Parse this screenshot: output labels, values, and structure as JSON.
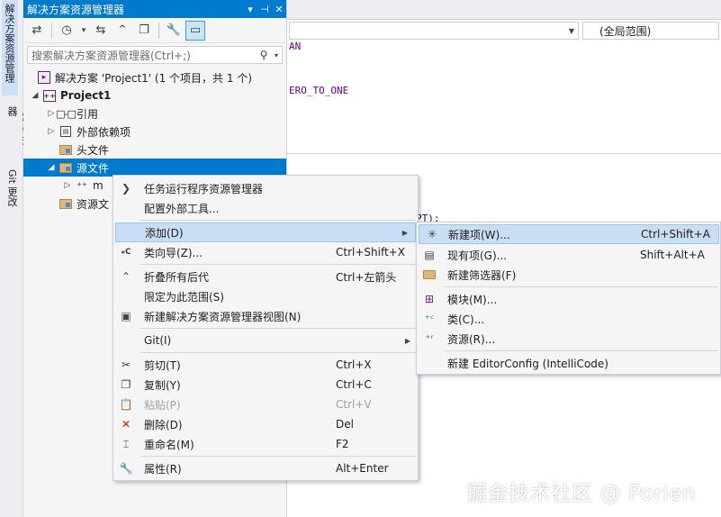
{
  "side_tabs": [
    "解决方案资源管理器",
    "属性管理器",
    "Git 更改"
  ],
  "solution_explorer": {
    "title": "解决方案资源管理器",
    "title_buttons": [
      "▾",
      "⊣",
      "✕"
    ],
    "search_placeholder": "搜索解决方案资源管理器(Ctrl+;)",
    "tree": [
      {
        "label": "解决方案 'Project1' (1 个项目，共 1 个)"
      },
      {
        "label": "Project1"
      },
      {
        "label": "引用"
      },
      {
        "label": "外部依赖项"
      },
      {
        "label": "头文件"
      },
      {
        "label": "源文件"
      },
      {
        "label": "m"
      },
      {
        "label": "资源文"
      }
    ]
  },
  "editor": {
    "scope_dropdown": "(全局范围)",
    "code_fragments": [
      "AN",
      "ERO_TO_ONE",
      "PT);"
    ]
  },
  "context_menu": {
    "items": [
      {
        "label": "任务运行程序资源管理器",
        "shortcut": ""
      },
      {
        "label": "配置外部工具...",
        "shortcut": ""
      },
      {
        "label": "添加(D)",
        "shortcut": ""
      },
      {
        "label": "类向导(Z)...",
        "shortcut": "Ctrl+Shift+X"
      },
      {
        "label": "折叠所有后代",
        "shortcut": "Ctrl+左箭头"
      },
      {
        "label": "限定为此范围(S)",
        "shortcut": ""
      },
      {
        "label": "新建解决方案资源管理器视图(N)",
        "shortcut": ""
      },
      {
        "label": "Git(I)",
        "shortcut": ""
      },
      {
        "label": "剪切(T)",
        "shortcut": "Ctrl+X"
      },
      {
        "label": "复制(Y)",
        "shortcut": "Ctrl+C"
      },
      {
        "label": "粘贴(P)",
        "shortcut": "Ctrl+V"
      },
      {
        "label": "删除(D)",
        "shortcut": "Del"
      },
      {
        "label": "重命名(M)",
        "shortcut": "F2"
      },
      {
        "label": "属性(R)",
        "shortcut": "Alt+Enter"
      }
    ]
  },
  "add_submenu": {
    "items": [
      {
        "label": "新建项(W)...",
        "shortcut": "Ctrl+Shift+A"
      },
      {
        "label": "现有项(G)...",
        "shortcut": "Shift+Alt+A"
      },
      {
        "label": "新建筛选器(F)",
        "shortcut": ""
      },
      {
        "label": "模块(M)...",
        "shortcut": ""
      },
      {
        "label": "类(C)...",
        "shortcut": ""
      },
      {
        "label": "资源(R)...",
        "shortcut": ""
      },
      {
        "label": "新建 EditorConfig (IntelliCode)",
        "shortcut": ""
      }
    ]
  },
  "watermark": "掘金技术社区 @ Porien",
  "colors": {
    "accent": "#007acc",
    "highlight": "#c9def5",
    "menu_bg": "#f5f5f5"
  }
}
